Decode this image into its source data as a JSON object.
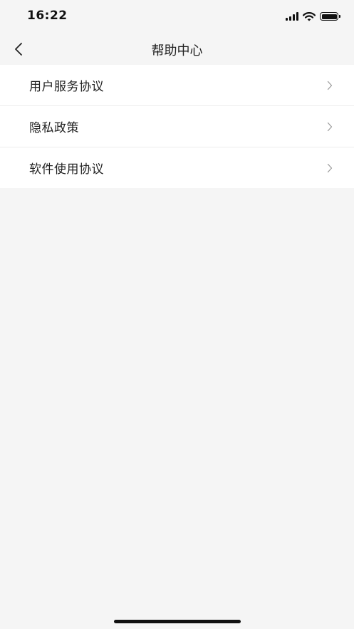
{
  "status_bar": {
    "time": "16:22",
    "icons": [
      "signal-icon",
      "wifi-icon",
      "battery-icon"
    ]
  },
  "nav": {
    "back_icon": "chevron-left-icon",
    "title": "帮助中心"
  },
  "menu": {
    "items": [
      {
        "label": "用户服务协议",
        "icon": "chevron-right-icon"
      },
      {
        "label": "隐私政策",
        "icon": "chevron-right-icon"
      },
      {
        "label": "软件使用协议",
        "icon": "chevron-right-icon"
      }
    ]
  },
  "colors": {
    "background": "#f5f5f5",
    "list_background": "#ffffff",
    "text": "#222222",
    "chevron": "#999999",
    "divider": "#ececec"
  }
}
